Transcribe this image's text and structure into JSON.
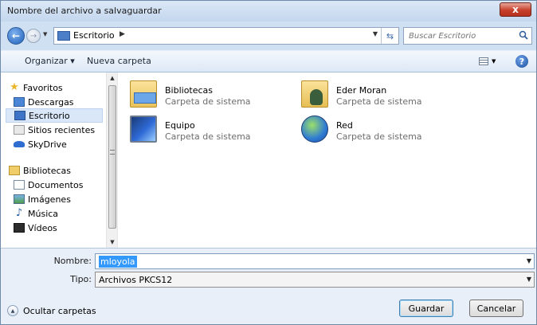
{
  "window": {
    "title": "Nombre del archivo a salvaguardar",
    "close_label": "x"
  },
  "address": {
    "location": "Escritorio",
    "search_placeholder": "Buscar Escritorio"
  },
  "toolbar": {
    "organize": "Organizar ▾",
    "new_folder": "Nueva carpeta"
  },
  "sidebar": {
    "favorites": "Favoritos",
    "downloads": "Descargas",
    "desktop": "Escritorio",
    "recent": "Sitios recientes",
    "skydrive": "SkyDrive",
    "libraries": "Bibliotecas",
    "documents": "Documentos",
    "images": "Imágenes",
    "music": "Música",
    "videos": "Vídeos",
    "selected": "Escritorio"
  },
  "files": [
    {
      "name": "Bibliotecas",
      "type": "Carpeta de sistema",
      "icon": "library-folder-icon"
    },
    {
      "name": "Eder Moran",
      "type": "Carpeta de sistema",
      "icon": "user-folder-icon"
    },
    {
      "name": "Equipo",
      "type": "Carpeta de sistema",
      "icon": "computer-icon"
    },
    {
      "name": "Red",
      "type": "Carpeta de sistema",
      "icon": "network-icon"
    }
  ],
  "form": {
    "name_label": "Nombre:",
    "name_value": "mloyola",
    "type_label": "Tipo:",
    "type_value": "Archivos PKCS12"
  },
  "footer": {
    "hide_folders": "Ocultar carpetas",
    "save": "Guardar",
    "cancel": "Cancelar"
  },
  "colors": {
    "selection": "#3399ff",
    "nav_selected": "#d9e7f8",
    "close": "#c7402b"
  }
}
